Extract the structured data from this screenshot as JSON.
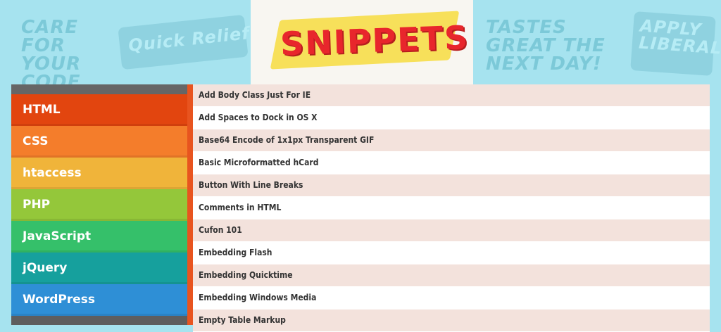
{
  "header": {
    "logo": "SNIPPETS",
    "stamps": [
      "CARE FOR YOUR CODE",
      "Quick Relief",
      "TASTES GREAT THE NEXT DAY!",
      "APPLY LIBERALLY"
    ]
  },
  "sidebar": {
    "items": [
      {
        "label": "HTML",
        "color": "#e2450f"
      },
      {
        "label": "CSS",
        "color": "#f47d2b"
      },
      {
        "label": "htaccess",
        "color": "#f0b43a"
      },
      {
        "label": "PHP",
        "color": "#94c73a"
      },
      {
        "label": "JavaScript",
        "color": "#35c06a"
      },
      {
        "label": "jQuery",
        "color": "#16a09d"
      },
      {
        "label": "WordPress",
        "color": "#2e8fd6"
      }
    ]
  },
  "snippets": [
    "Add Body Class Just For IE",
    "Add Spaces to Dock in OS X",
    "Base64 Encode of 1x1px Transparent GIF",
    "Basic Microformatted hCard",
    "Button With Line Breaks",
    "Comments in HTML",
    "Cufon 101",
    "Embedding Flash",
    "Embedding Quicktime",
    "Embedding Windows Media",
    "Empty Table Markup"
  ]
}
